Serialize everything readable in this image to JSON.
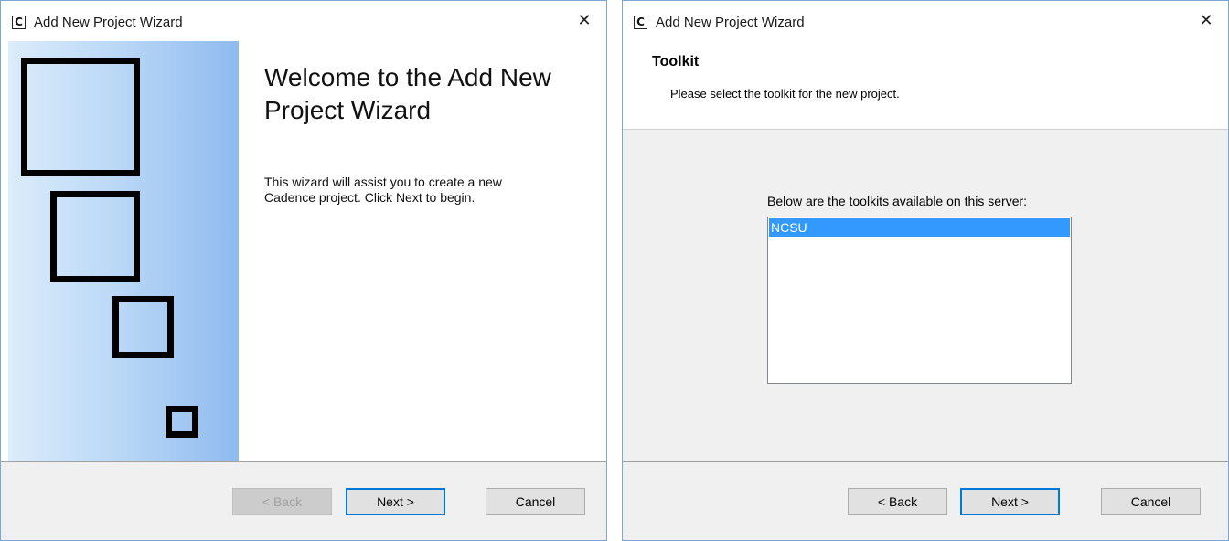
{
  "window1": {
    "title": "Add New Project Wizard",
    "app_icon_glyph": "C",
    "close_glyph": "✕",
    "welcome_title": "Welcome to the Add New Project Wizard",
    "welcome_body": "This wizard will assist you to create a new Cadence project. Click Next to begin.",
    "buttons": {
      "back": "< Back",
      "next": "Next >",
      "cancel": "Cancel"
    },
    "back_enabled": false
  },
  "window2": {
    "title": "Add New Project Wizard",
    "app_icon_glyph": "C",
    "close_glyph": "✕",
    "page_title": "Toolkit",
    "page_subtitle": "Please select the toolkit for the new project.",
    "list_label": "Below are the toolkits available on this server:",
    "toolkits": [
      "NCSU"
    ],
    "selected_toolkit": "NCSU",
    "buttons": {
      "back": "< Back",
      "next": "Next >",
      "cancel": "Cancel"
    }
  },
  "colors": {
    "accent": "#0078d7",
    "selection": "#3399ff",
    "panel_gradient_start": "#dcecfb",
    "panel_gradient_end": "#8fbbef",
    "footer_bg": "#f0f0f0"
  }
}
